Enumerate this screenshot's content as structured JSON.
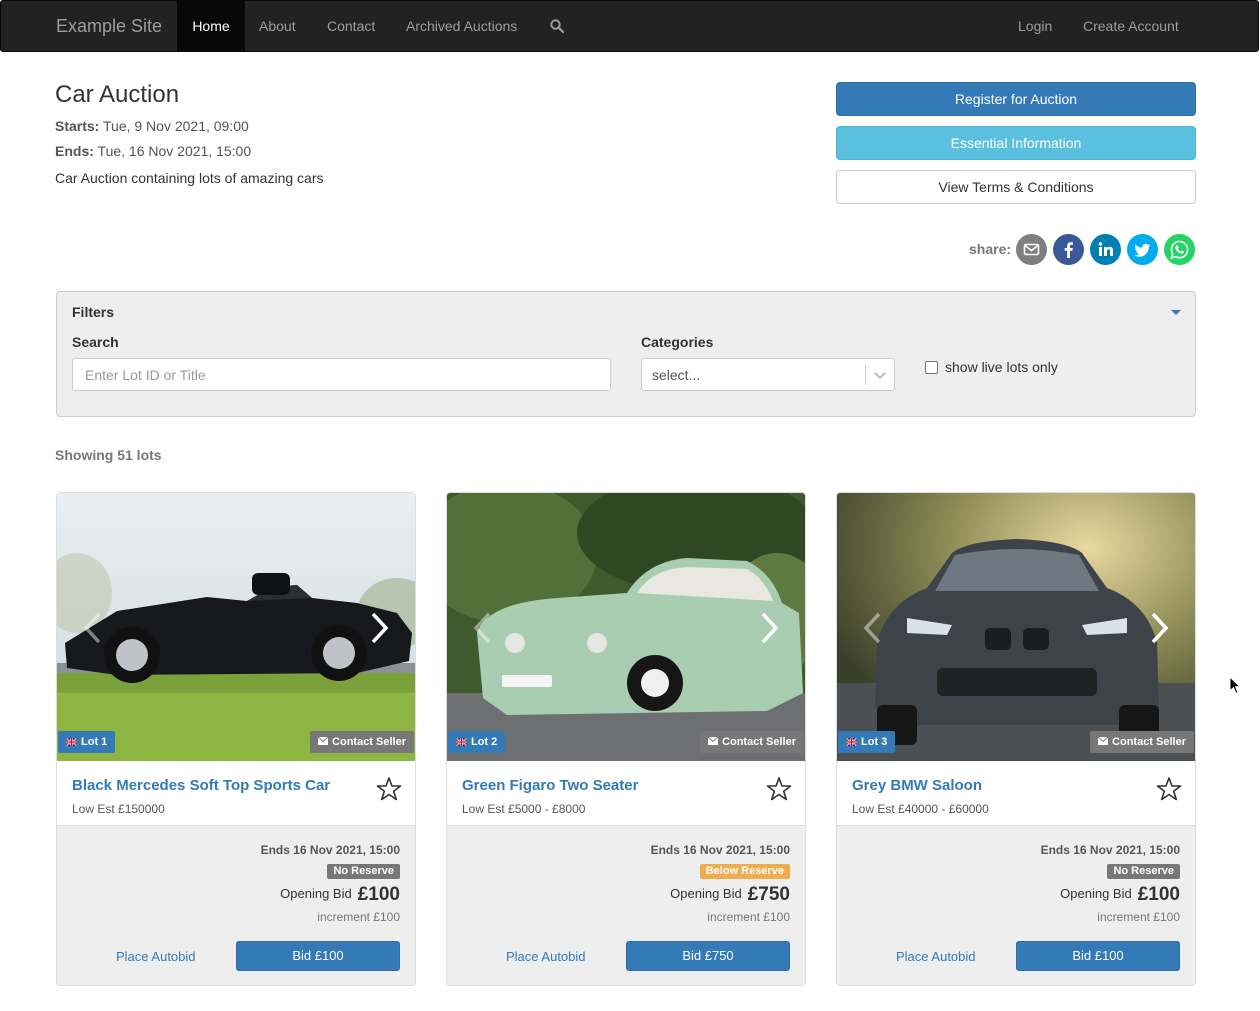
{
  "nav": {
    "brand": "Example Site",
    "home": "Home",
    "about": "About",
    "contact": "Contact",
    "archived": "Archived Auctions",
    "login": "Login",
    "create_account": "Create Account"
  },
  "auction": {
    "title": "Car Auction",
    "starts_label": "Starts:",
    "starts": "Tue, 9 Nov 2021, 09:00",
    "ends_label": "Ends:",
    "ends": "Tue, 16 Nov 2021, 15:00",
    "description": "Car Auction containing lots of amazing cars"
  },
  "actions": {
    "register": "Register for Auction",
    "essential": "Essential Information",
    "terms": "View Terms & Conditions",
    "share_label": "share:"
  },
  "share_icons": [
    "email-icon",
    "facebook-icon",
    "linkedin-icon",
    "twitter-icon",
    "whatsapp-icon"
  ],
  "filters": {
    "title": "Filters",
    "search_label": "Search",
    "search_placeholder": "Enter Lot ID or Title",
    "categories_label": "Categories",
    "categories_placeholder": "select...",
    "live_only_label": "show live lots only",
    "live_only_checked": false
  },
  "showing": "Showing 51 lots",
  "colors": {
    "primary": "#337ab7",
    "info": "#5bc0de",
    "no_reserve": "#777777",
    "below_reserve": "#f0ad4e"
  },
  "lots": [
    {
      "badge": "Lot 1",
      "contact": "Contact Seller",
      "title": "Black Mercedes Soft Top Sports Car",
      "estimate": "Low Est £150000",
      "ends": "Ends 16 Nov 2021, 15:00",
      "reserve": "No Reserve",
      "opening_label": "Opening Bid",
      "opening_value": "£100",
      "increment": "increment £100",
      "autobid": "Place Autobid",
      "bid": "Bid £100"
    },
    {
      "badge": "Lot 2",
      "contact": "Contact Seller",
      "title": "Green Figaro Two Seater",
      "estimate": "Low Est £5000 - £8000",
      "ends": "Ends 16 Nov 2021, 15:00",
      "reserve": "Below Reserve",
      "opening_label": "Opening Bid",
      "opening_value": "£750",
      "increment": "increment £100",
      "autobid": "Place Autobid",
      "bid": "Bid £750"
    },
    {
      "badge": "Lot 3",
      "contact": "Contact Seller",
      "title": "Grey BMW Saloon",
      "estimate": "Low Est £40000 - £60000",
      "ends": "Ends 16 Nov 2021, 15:00",
      "reserve": "No Reserve",
      "opening_label": "Opening Bid",
      "opening_value": "£100",
      "increment": "increment £100",
      "autobid": "Place Autobid",
      "bid": "Bid £100"
    }
  ]
}
